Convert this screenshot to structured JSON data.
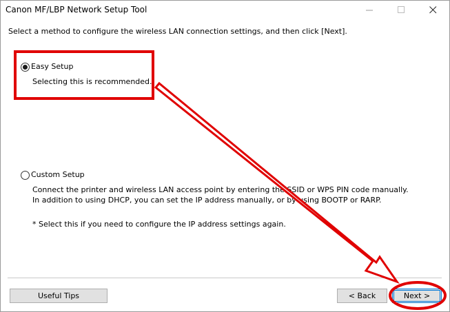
{
  "window": {
    "title": "Canon MF/LBP Network Setup Tool"
  },
  "instruction": "Select a method to configure the wireless LAN connection settings, and then click [Next].",
  "options": [
    {
      "label": "Easy Setup",
      "checked": true,
      "description": [
        "Selecting this is recommended."
      ]
    },
    {
      "label": "Custom Setup",
      "checked": false,
      "description": [
        "Connect the printer and wireless LAN access point by entering the SSID or WPS PIN code manually.",
        "In addition to using DHCP, you can set the IP address manually, or by using BOOTP or RARP."
      ],
      "note": "* Select this if you need to configure the IP address settings again."
    }
  ],
  "buttons": {
    "tips": "Useful Tips",
    "back": "< Back",
    "next": "Next >"
  },
  "colors": {
    "annotation": "#e00000",
    "focus": "#0078d7"
  },
  "icons": {
    "minimize": "minimize-icon",
    "maximize": "maximize-icon",
    "close": "close-icon"
  }
}
